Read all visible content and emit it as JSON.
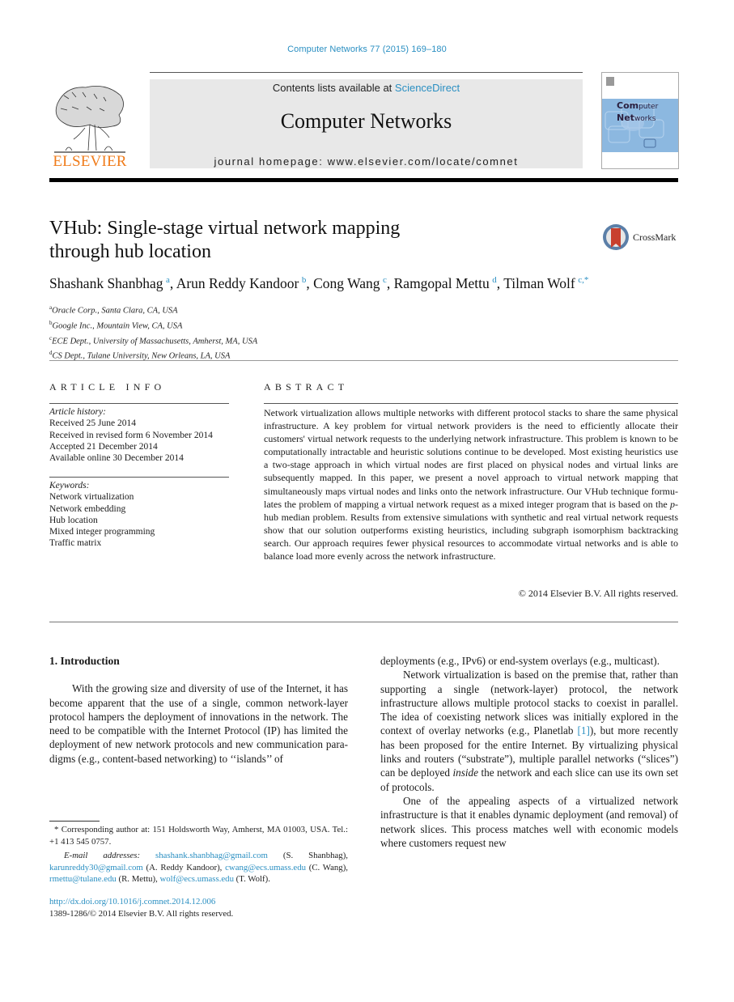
{
  "header": {
    "journal_reference": "Computer Networks 77 (2015) 169–180",
    "contents_prefix": "Contents lists available at ",
    "contents_link": "ScienceDirect",
    "journal_title": "Computer Networks",
    "homepage": "journal homepage: www.elsevier.com/locate/comnet",
    "publisher_wordmark": "ELSEVIER",
    "cover_title_line1_bold": "Com",
    "cover_title_line1_rest": "puter",
    "cover_title_line2_bold": "Net",
    "cover_title_line2_rest": "works",
    "crossmark_label": "CrossMark",
    "colors": {
      "link": "#2a8fc2",
      "elsevier_orange": "#f07c1b",
      "masthead_bg": "#e8e8e8",
      "cover_band": "#8cb8e0"
    }
  },
  "article": {
    "title_line1": "VHub: Single-stage virtual network mapping",
    "title_line2": "through hub location",
    "authors": [
      {
        "name": "Shashank Shanbhag",
        "sup": "a"
      },
      {
        "name": "Arun Reddy Kandoor",
        "sup": "b"
      },
      {
        "name": "Cong Wang",
        "sup": "c"
      },
      {
        "name": "Ramgopal Mettu",
        "sup": "d"
      },
      {
        "name": "Tilman Wolf",
        "sup": "c,*"
      }
    ],
    "affiliations": [
      {
        "sup": "a",
        "text": "Oracle Corp., Santa Clara, CA, USA"
      },
      {
        "sup": "b",
        "text": "Google Inc., Mountain View, CA, USA"
      },
      {
        "sup": "c",
        "text": "ECE Dept., University of Massachusetts, Amherst, MA, USA"
      },
      {
        "sup": "d",
        "text": "CS Dept., Tulane University, New Orleans, LA, USA"
      }
    ]
  },
  "article_info": {
    "heading": "ARTICLE INFO",
    "history_label": "Article history:",
    "history": [
      "Received 25 June 2014",
      "Received in revised form 6 November 2014",
      "Accepted 21 December 2014",
      "Available online 30 December 2014"
    ],
    "keywords_label": "Keywords:",
    "keywords": [
      "Network virtualization",
      "Network embedding",
      "Hub location",
      "Mixed integer programming",
      "Traffic matrix"
    ]
  },
  "abstract": {
    "heading": "ABSTRACT",
    "text_before_p": "Network virtualization allows multiple networks with different protocol stacks to share the same physical infrastructure. A key problem for virtual network providers is the need to efficiently allocate their customers' virtual network requests to the underlying network infrastructure. This problem is known to be computationally intractable and heuristic solu­tions continue to be developed. Most existing heuristics use a two-stage approach in which virtual nodes are first placed on physical nodes and virtual links are subsequently mapped. In this paper, we present a novel approach to virtual network mapping that simultaneously maps virtual nodes and links onto the network infrastructure. Our VHub technique formu­lates the problem of mapping a virtual network request as a mixed integer program that is based on the ",
    "p_italic": "p",
    "text_after_p": "-hub median problem. Results from extensive simulations with synthetic and real virtual network requests show that our solution outperforms existing heuristics, including subgraph isomorphism backtracking search. Our approach requires fewer phys­ical resources to accommodate virtual networks and is able to balance load more evenly across the network infrastructure.",
    "copyright": "© 2014 Elsevier B.V. All rights reserved."
  },
  "body": {
    "section_heading": "1. Introduction",
    "left_paragraph": "With the growing size and diversity of use of the Inter­net, it has become apparent that the use of a single, com­mon network-layer protocol hampers the deployment of innovations in the network. The need to be compatible with the Internet Protocol (IP) has limited the deployment of new network protocols and new communication para­digms (e.g., content-based networking) to ‘‘islands’’ of",
    "right_cont": "deployments (e.g., IPv6) or end-system overlays (e.g., multicast).",
    "right_p2_before_ref": "Network virtualization is based on the premise that, rather than supporting a single (network-layer) protocol, the network infrastructure allows multiple protocol stacks to coexist in parallel. The idea of coexisting network slices was initially explored in the context of overlay networks (e.g., Planetlab ",
    "right_p2_ref": "[1]",
    "right_p2_after_ref": "), but more recently has been proposed for the entire Internet. By virtualizing physical links and routers (“substrate”), multiple parallel networks (“slices”) can be deployed ",
    "right_p2_italic": "inside",
    "right_p2_end": " the network and each slice can use its own set of protocols.",
    "right_p3": "One of the appealing aspects of a virtualized network infrastructure is that it enables dynamic deployment (and removal) of network slices. This process matches well with economic models where customers request new"
  },
  "footnotes": {
    "corresponding": "* Corresponding author at: 151 Holdsworth Way, Amherst, MA 01003, USA. Tel.: +1 413 545 0757.",
    "email_label": "E-mail addresses:",
    "emails": [
      {
        "address": "shashank.shanbhag@gmail.com",
        "who": " (S. Shanbhag), "
      },
      {
        "address": "karunreddy30@gmail.com",
        "who": " (A. Reddy Kandoor), "
      },
      {
        "address": "cwang@ecs.umass.edu",
        "who": " (C. Wang), "
      },
      {
        "address": "rmettu@tulane.edu",
        "who": " (R. Mettu), "
      },
      {
        "address": "wolf@ecs.umass.edu",
        "who": " (T. Wolf)."
      }
    ],
    "doi": "http://dx.doi.org/10.1016/j.comnet.2014.12.006",
    "issn_line": "1389-1286/© 2014 Elsevier B.V. All rights reserved."
  }
}
